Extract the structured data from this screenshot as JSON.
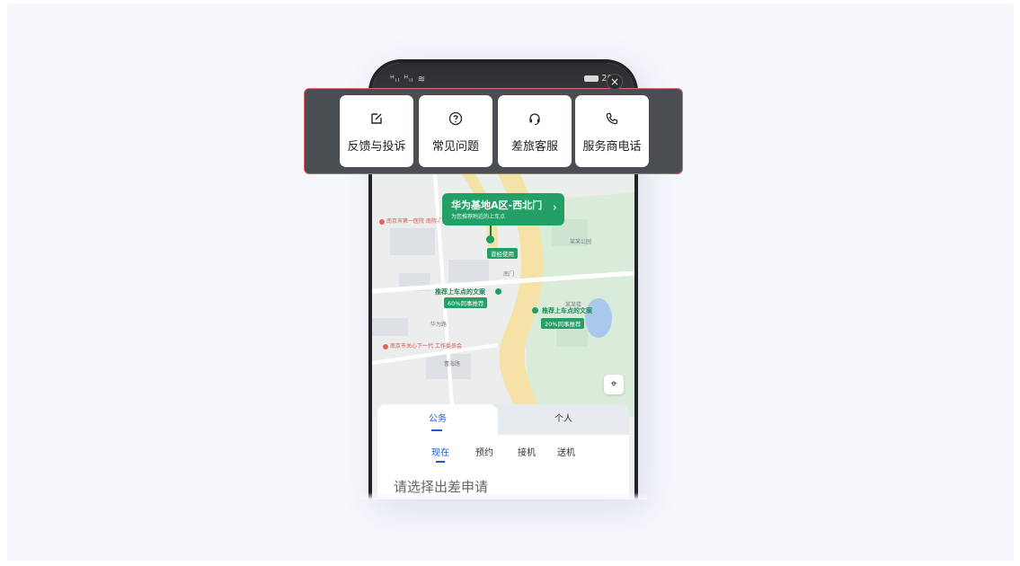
{
  "status_bar": {
    "signal": "ᴴᵢₗ ᴴᵢₗ ≋",
    "battery": "20"
  },
  "close_icon": "×",
  "actions": [
    {
      "label": "反馈与投诉",
      "icon": "edit-icon"
    },
    {
      "label": "常见问题",
      "icon": "help-icon"
    },
    {
      "label": "差旅客服",
      "icon": "headset-icon"
    },
    {
      "label": "服务商电话",
      "icon": "phone-icon"
    }
  ],
  "map": {
    "pickup_bubble": {
      "title": "华为基地A区-西北门",
      "subtitle": "为您推荐附近的上车点",
      "chevron": "›"
    },
    "used_before_tag": "曾经使用",
    "recommend_1": {
      "text": "推荐上车点的文案",
      "tag": "60%同事推荐"
    },
    "recommend_2": {
      "text": "推荐上车点的文案",
      "tag": "20%同事推荐"
    },
    "labels": {
      "hospital": "南京市第一医院 南院-门诊楼",
      "committee": "南京市关心下一代 工作委员会",
      "road_1": "华为路",
      "road_2": "曹海路",
      "gate": "南门",
      "bldg_a": "某某楼",
      "park": "某某公园"
    },
    "locate_icon": "⌖"
  },
  "panel": {
    "tabs": [
      "公务",
      "个人"
    ],
    "sub_tabs": [
      "现在",
      "预约",
      "接机",
      "送机"
    ],
    "apply_prompt": "请选择出差申请"
  },
  "colors": {
    "accent": "#1a5cc8",
    "brand_green": "#22a066",
    "overlay_border": "#e2686c"
  }
}
